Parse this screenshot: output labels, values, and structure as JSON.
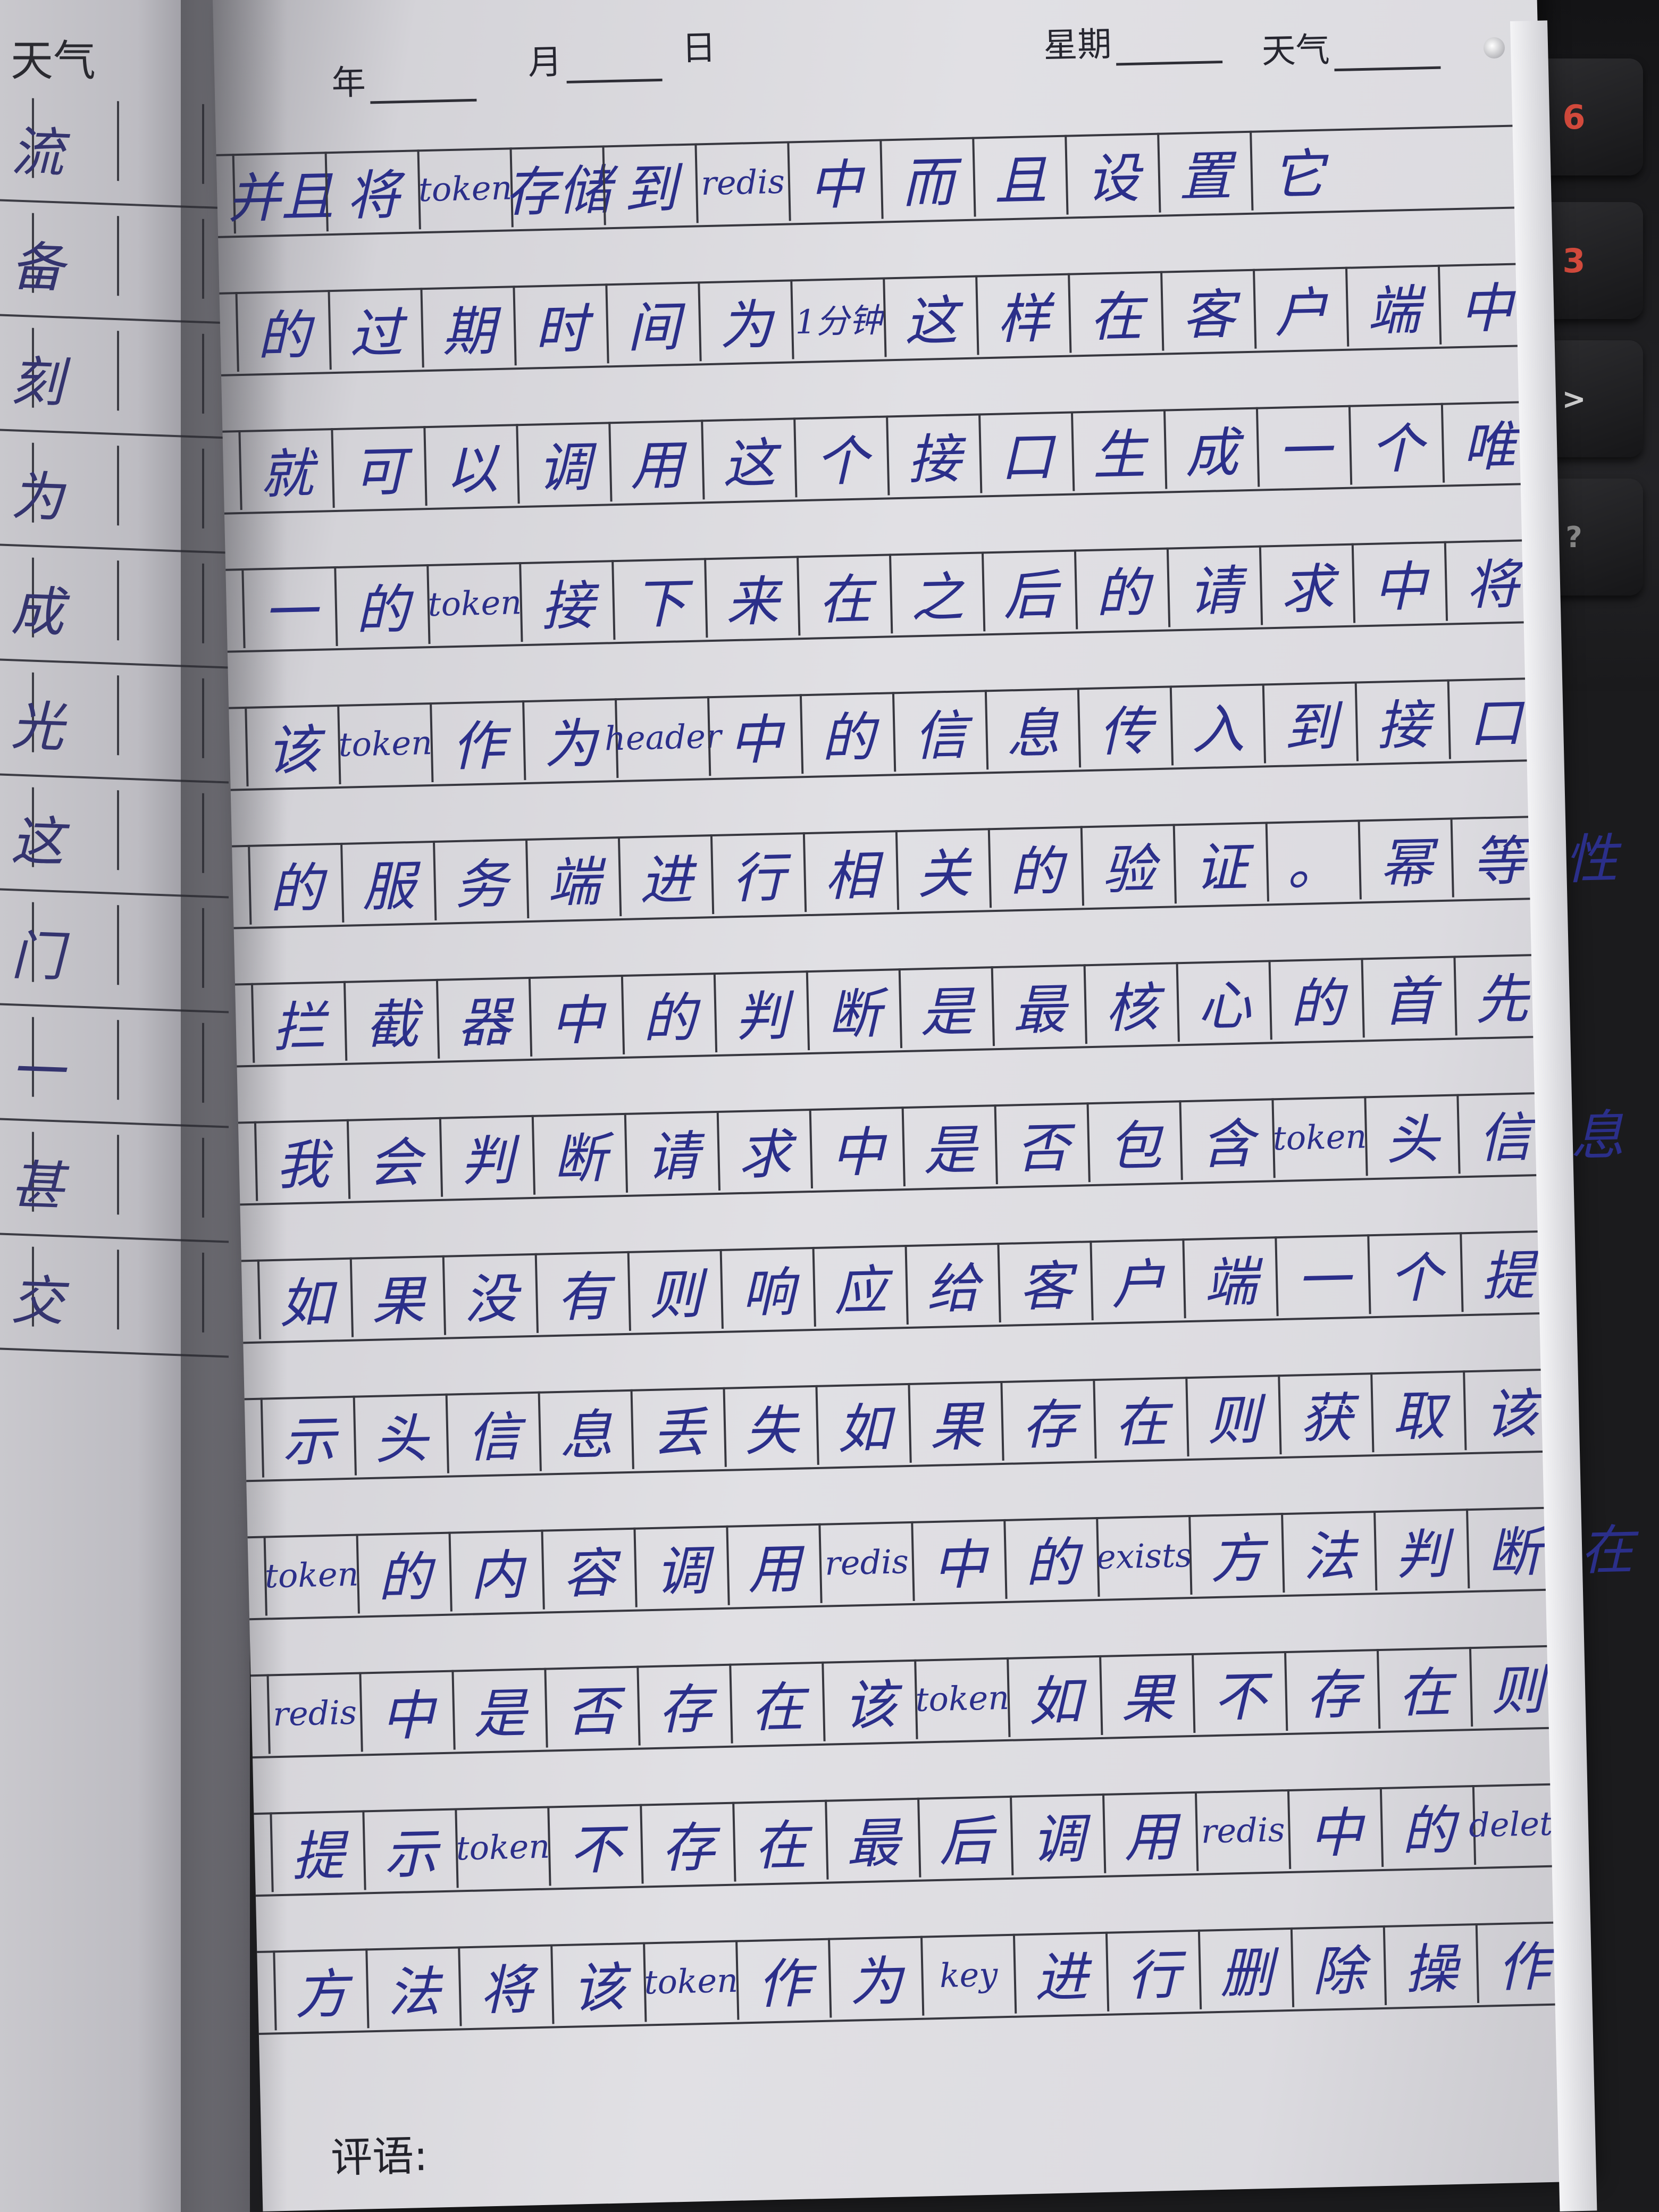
{
  "left_page": {
    "header": "天气",
    "column_chars": [
      "流",
      "备",
      "刻",
      "为",
      "成",
      "光",
      "这",
      "门",
      "一",
      "甚",
      "交"
    ],
    "second_column_chars": [
      "",
      "",
      "",
      "",
      "",
      "",
      "",
      "",
      "",
      "",
      ""
    ]
  },
  "header": {
    "year_label": "年",
    "month_label": "月",
    "day_label": "日",
    "weekday_label": "星期",
    "weather_label": "天气"
  },
  "keyboard": {
    "key_1": "6",
    "key_2": "3",
    "key_3": ">",
    "key_4": "?"
  },
  "rows": [
    [
      "并且",
      "将",
      "token",
      "存储",
      "到",
      "redis",
      "中",
      "而",
      "且",
      "设",
      "置",
      "它"
    ],
    [
      "的",
      "过",
      "期",
      "时",
      "间",
      "为",
      "1分钟",
      "这",
      "样",
      "在",
      "客",
      "户",
      "端",
      "中"
    ],
    [
      "就",
      "可",
      "以",
      "调",
      "用",
      "这",
      "个",
      "接",
      "口",
      "生",
      "成",
      "一",
      "个",
      "唯"
    ],
    [
      "一",
      "的",
      "token",
      "接",
      "下",
      "来",
      "在",
      "之",
      "后",
      "的",
      "请",
      "求",
      "中",
      "将"
    ],
    [
      "该",
      "token",
      "作",
      "为",
      "header",
      "中",
      "的",
      "信",
      "息",
      "传",
      "入",
      "到",
      "接",
      "口"
    ],
    [
      "的",
      "服",
      "务",
      "端",
      "进",
      "行",
      "相",
      "关",
      "的",
      "验",
      "证",
      "。",
      "幂",
      "等",
      "性"
    ],
    [
      "拦",
      "截",
      "器",
      "中",
      "的",
      "判",
      "断",
      "是",
      "最",
      "核",
      "心",
      "的",
      "首",
      "先"
    ],
    [
      "我",
      "会",
      "判",
      "断",
      "请",
      "求",
      "中",
      "是",
      "否",
      "包",
      "含",
      "token",
      "头",
      "信",
      "息"
    ],
    [
      "如",
      "果",
      "没",
      "有",
      "则",
      "响",
      "应",
      "给",
      "客",
      "户",
      "端",
      "一",
      "个",
      "提"
    ],
    [
      "示",
      "头",
      "信",
      "息",
      "丢",
      "失",
      "如",
      "果",
      "存",
      "在",
      "则",
      "获",
      "取",
      "该"
    ],
    [
      "token",
      "的",
      "内",
      "容",
      "调",
      "用",
      "redis",
      "中",
      "的",
      "exists",
      "方",
      "法",
      "判",
      "断",
      "在"
    ],
    [
      "redis",
      "中",
      "是",
      "否",
      "存",
      "在",
      "该",
      "token",
      "如",
      "果",
      "不",
      "存",
      "在",
      "则"
    ],
    [
      "提",
      "示",
      "token",
      "不",
      "存",
      "在",
      "最",
      "后",
      "调",
      "用",
      "redis",
      "中",
      "的",
      "delete"
    ],
    [
      "方",
      "法",
      "将",
      "该",
      "token",
      "作",
      "为",
      "key",
      "进",
      "行",
      "删",
      "除",
      "操",
      "作"
    ]
  ],
  "footer": {
    "comment_label": "评语:"
  }
}
